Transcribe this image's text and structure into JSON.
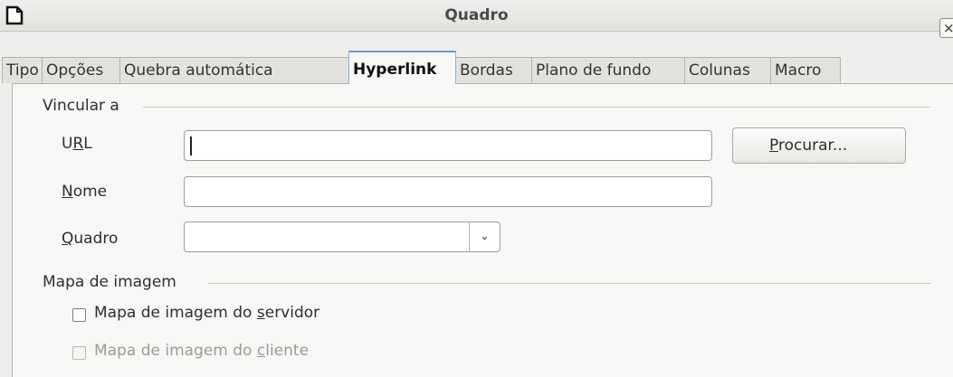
{
  "window": {
    "title": "Quadro",
    "close_label": "×",
    "icon": "document-icon"
  },
  "tabs": [
    "Tipo",
    "Opções",
    "Quebra automática",
    "Hyperlink",
    "Bordas",
    "Plano de fundo",
    "Colunas",
    "Macro"
  ],
  "active_tab": "Hyperlink",
  "link_section": {
    "label": "Vincular a",
    "url": {
      "label_pre": "U",
      "label_mnemonic": "R",
      "label_post": "L",
      "value": ""
    },
    "name": {
      "label_mnemonic": "N",
      "label_post": "ome",
      "value": ""
    },
    "frame": {
      "label_mnemonic": "Q",
      "label_post": "uadro",
      "value": ""
    },
    "browse_button": {
      "mnemonic": "P",
      "rest": "rocurar..."
    }
  },
  "image_map_section": {
    "label": "Mapa de imagem",
    "server": {
      "pre": "Mapa de imagem do ",
      "mnemonic": "s",
      "post": "ervidor",
      "checked": false,
      "enabled": true
    },
    "client": {
      "pre": "Mapa de imagem do ",
      "mnemonic": "c",
      "post": "liente",
      "checked": false,
      "enabled": false
    }
  }
}
